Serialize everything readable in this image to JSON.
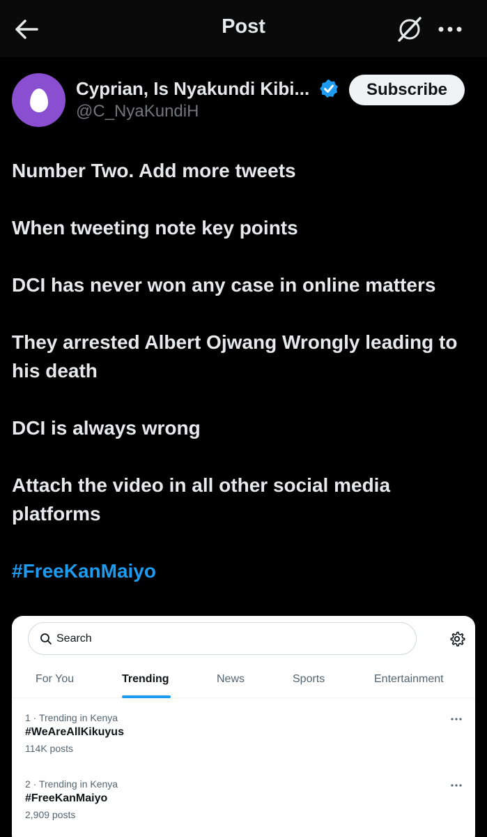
{
  "header": {
    "title": "Post",
    "back_icon": "arrow-left-icon",
    "grok_icon": "grok-slash-icon",
    "more_icon": "more-dots-icon"
  },
  "author": {
    "name": "Cyprian, Is Nyakundi Kibi...",
    "handle": "@C_NyaKundiH",
    "verified": true,
    "subscribe_label": "Subscribe",
    "avatar_color": "#8a4fd0"
  },
  "post": {
    "lines": [
      "Number Two. Add more tweets",
      "When tweeting note key points",
      "DCI has never won any case in online matters",
      "They arrested Albert Ojwang Wrongly leading to his death",
      "DCI is always wrong",
      "Attach the video in all other social media platforms"
    ],
    "hashtag": "#FreeKanMaiyo"
  },
  "embedded": {
    "search_placeholder": "Search",
    "tabs": [
      "For You",
      "Trending",
      "News",
      "Sports",
      "Entertainment"
    ],
    "active_tab": "Trending",
    "trends": [
      {
        "meta": "1 · Trending in Kenya",
        "tag": "#WeAreAllKikuyus",
        "count": "114K posts"
      },
      {
        "meta": "2 · Trending in Kenya",
        "tag": "#FreeKanMaiyo",
        "count": "2,909 posts"
      }
    ]
  },
  "colors": {
    "background": "#000000",
    "text": "#e7e9ea",
    "muted": "#71767b",
    "accent": "#1d9bf0"
  }
}
